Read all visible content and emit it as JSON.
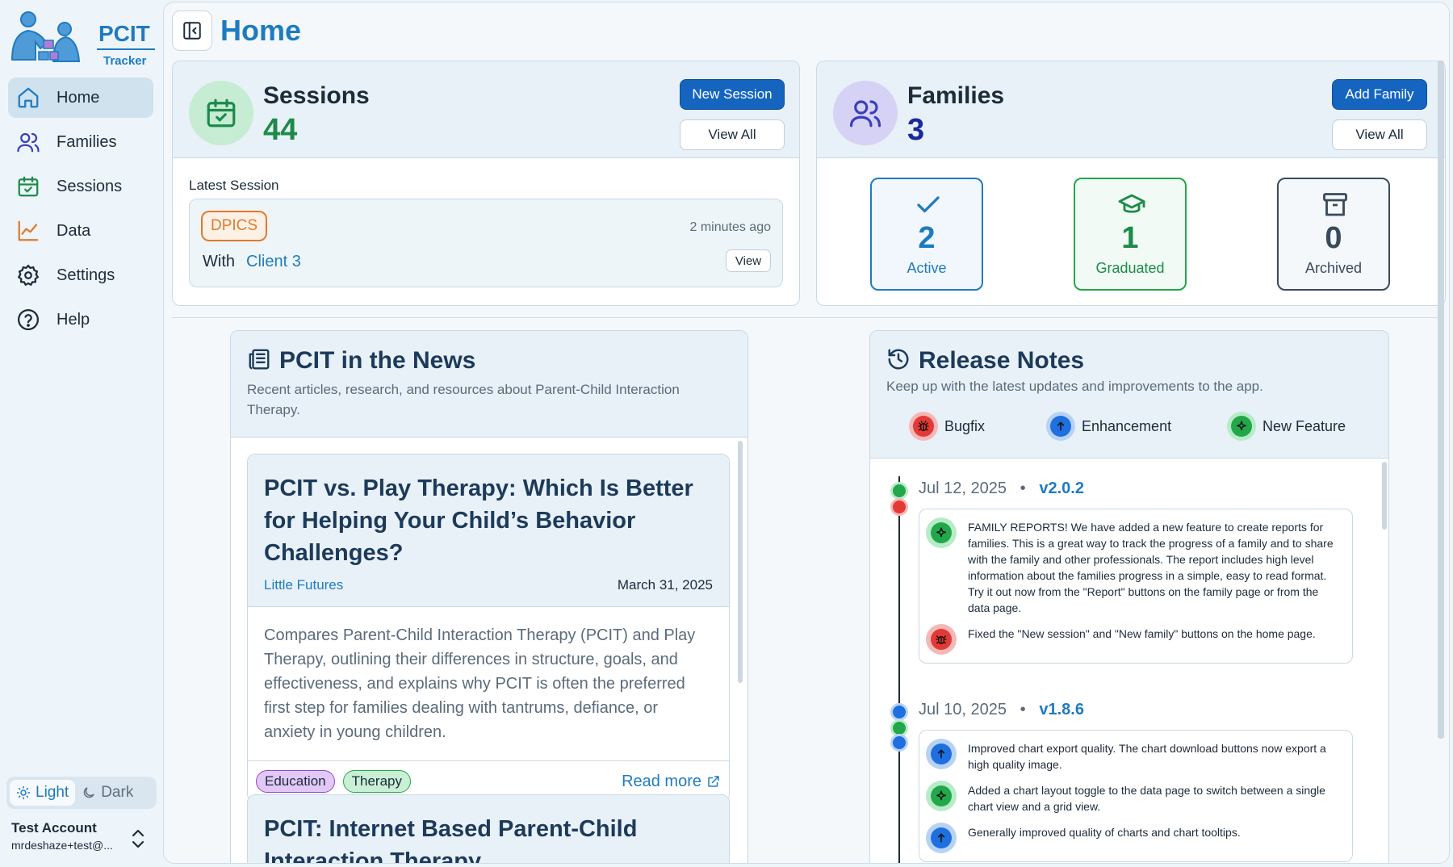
{
  "app": {
    "logo_title": "PCIT",
    "logo_sub": "Tracker"
  },
  "sidebar": {
    "items": [
      {
        "label": "Home",
        "icon": "home-icon"
      },
      {
        "label": "Families",
        "icon": "users-icon"
      },
      {
        "label": "Sessions",
        "icon": "calendar-check-icon"
      },
      {
        "label": "Data",
        "icon": "chart-line-icon"
      },
      {
        "label": "Settings",
        "icon": "gear-icon"
      },
      {
        "label": "Help",
        "icon": "help-circle-icon"
      }
    ],
    "theme_light": "Light",
    "theme_dark": "Dark",
    "account_name": "Test Account",
    "account_email": "mrdeshaze+test@..."
  },
  "page": {
    "title": "Home"
  },
  "sessions": {
    "label": "Sessions",
    "count": "44",
    "new_button": "New Session",
    "view_all": "View All",
    "latest_label": "Latest Session",
    "latest": {
      "tag": "DPICS",
      "time_ago": "2 minutes ago",
      "with_label": "With",
      "client": "Client 3",
      "view": "View"
    }
  },
  "families": {
    "label": "Families",
    "count": "3",
    "add_button": "Add Family",
    "view_all": "View All",
    "stats": [
      {
        "value": "2",
        "label": "Active"
      },
      {
        "value": "1",
        "label": "Graduated"
      },
      {
        "value": "0",
        "label": "Archived"
      }
    ]
  },
  "news": {
    "title": "PCIT in the News",
    "description": "Recent articles, research, and resources about Parent-Child Interaction Therapy.",
    "articles": [
      {
        "title": "PCIT vs. Play Therapy: Which Is Better for Helping Your Child’s Behavior Challenges?",
        "source": "Little Futures",
        "date": "March 31, 2025",
        "summary": "Compares Parent-Child Interaction Therapy (PCIT) and Play Therapy, outlining their differences in structure, goals, and effectiveness, and explains why PCIT is often the preferred first step for families dealing with tantrums, defiance, or anxiety in young children.",
        "tags": [
          "Education",
          "Therapy"
        ],
        "read_more": "Read more"
      },
      {
        "title": "PCIT: Internet Based Parent-Child Interaction Therapy"
      }
    ]
  },
  "release_notes": {
    "title": "Release Notes",
    "description": "Keep up with the latest updates and improvements to the app.",
    "legend": [
      {
        "label": "Bugfix",
        "color": "#e53935"
      },
      {
        "label": "Enhancement",
        "color": "#1e6fe0"
      },
      {
        "label": "New Feature",
        "color": "#22a84a"
      }
    ],
    "releases": [
      {
        "date": "Jul 12, 2025",
        "version": "v2.0.2",
        "items": [
          {
            "type": "feature",
            "text": "FAMILY REPORTS! We have added a new feature to create reports for families. This is a great way to track the progress of a family and to share with the family and other professionals. The report includes high level information about the families progress in a simple, easy to read format. Try it out now from the \"Report\" buttons on the family page or from the data page."
          },
          {
            "type": "bugfix",
            "text": "Fixed the \"New session\" and \"New family\" buttons on the home page."
          }
        ]
      },
      {
        "date": "Jul 10, 2025",
        "version": "v1.8.6",
        "items": [
          {
            "type": "enhancement",
            "text": "Improved chart export quality. The chart download buttons now export a high quality image."
          },
          {
            "type": "feature",
            "text": "Added a chart layout toggle to the data page to switch between a single chart view and a grid view."
          },
          {
            "type": "enhancement",
            "text": "Generally improved quality of charts and chart tooltips."
          }
        ]
      }
    ]
  },
  "colors": {
    "accent": "#1f7bc0",
    "primary_button": "#1565c0",
    "sessions_green": "#1e8a4a",
    "families_navy": "#1b2a9e"
  }
}
